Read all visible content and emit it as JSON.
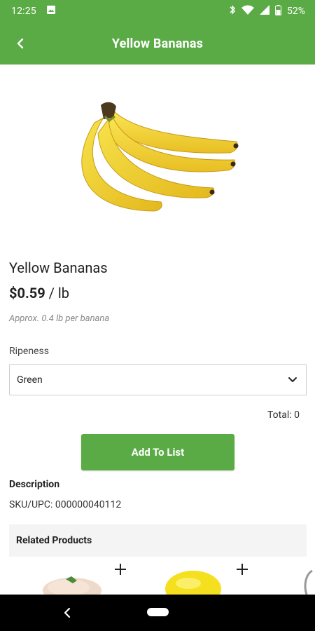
{
  "status_bar": {
    "time": "12:25",
    "battery": "52%",
    "icons": [
      "image-icon",
      "bluetooth-icon",
      "wifi-icon",
      "cell-signal-icon",
      "battery-icon"
    ]
  },
  "app_bar": {
    "title": "Yellow Bananas",
    "back_icon": "back-arrow-icon"
  },
  "product": {
    "name": "Yellow Bananas",
    "price_amount": "$0.59",
    "price_unit": " / lb",
    "approx_text": "Approx. 0.4 lb per banana",
    "image": "bananas-image"
  },
  "ripeness": {
    "label": "Ripeness",
    "selected": "Green"
  },
  "total_text": "Total: 0",
  "add_button_label": "Add To List",
  "description": {
    "heading": "Description",
    "sku": "SKU/UPC: 000000040112"
  },
  "related": {
    "heading": "Related Products",
    "items": [
      {
        "image": "chicken-breast-image",
        "add_icon": "plus-icon"
      },
      {
        "image": "lemon-image",
        "add_icon": "plus-icon"
      },
      {
        "image": "partial-product-image"
      }
    ]
  },
  "colors": {
    "brand_green": "#5aab45",
    "related_bg": "#f4f4f4"
  }
}
